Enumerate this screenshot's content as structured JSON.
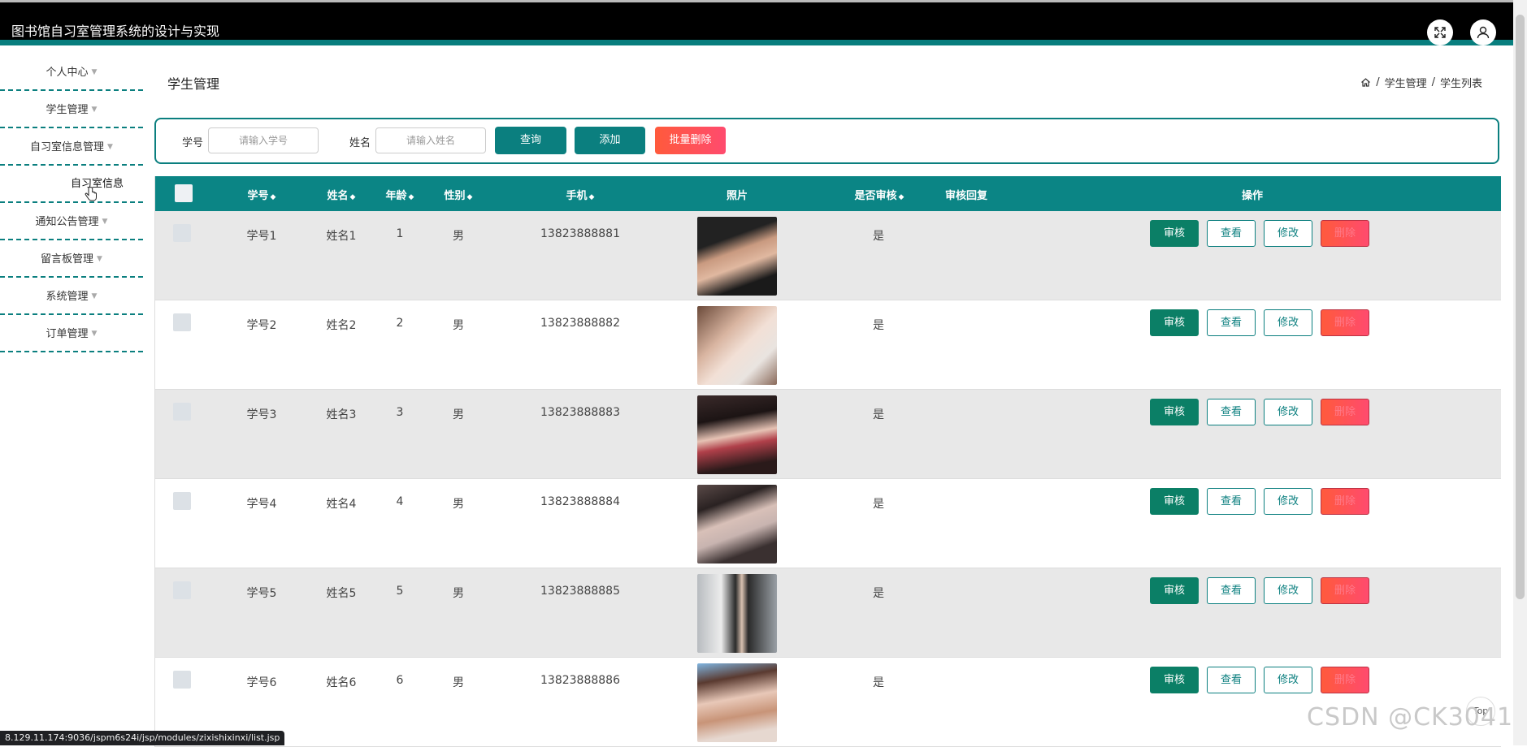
{
  "app": {
    "title": "图书馆自习室管理系统的设计与实现"
  },
  "header": {
    "fullscreen_icon": "expand-icon",
    "user_icon": "user-icon"
  },
  "sidebar": {
    "items": [
      {
        "label": "个人中心"
      },
      {
        "label": "学生管理"
      },
      {
        "label": "自习室信息管理"
      },
      {
        "label": "自习室信息"
      },
      {
        "label": "通知公告管理"
      },
      {
        "label": "留言板管理"
      },
      {
        "label": "系统管理"
      },
      {
        "label": "订单管理"
      }
    ]
  },
  "page": {
    "title": "学生管理"
  },
  "breadcrumb": {
    "home_icon": "home-icon",
    "sep": "/",
    "level1": "学生管理",
    "level2": "学生列表"
  },
  "search": {
    "student_id_label": "学号",
    "student_id_placeholder": "请输入学号",
    "name_label": "姓名",
    "name_placeholder": "请输入姓名",
    "query_button": "查询",
    "add_button": "添加",
    "batch_delete_button": "批量删除"
  },
  "table": {
    "columns": [
      "学号",
      "姓名",
      "年龄",
      "性别",
      "手机",
      "照片",
      "是否审核",
      "审核回复",
      "操作"
    ],
    "actions": {
      "audit": "审核",
      "view": "查看",
      "edit": "修改",
      "delete": "删除"
    },
    "rows": [
      {
        "student_id": "学号1",
        "name": "姓名1",
        "age": "1",
        "gender": "男",
        "phone": "13823888881",
        "reviewed": "是",
        "reply": ""
      },
      {
        "student_id": "学号2",
        "name": "姓名2",
        "age": "2",
        "gender": "男",
        "phone": "13823888882",
        "reviewed": "是",
        "reply": ""
      },
      {
        "student_id": "学号3",
        "name": "姓名3",
        "age": "3",
        "gender": "男",
        "phone": "13823888883",
        "reviewed": "是",
        "reply": ""
      },
      {
        "student_id": "学号4",
        "name": "姓名4",
        "age": "4",
        "gender": "男",
        "phone": "13823888884",
        "reviewed": "是",
        "reply": ""
      },
      {
        "student_id": "学号5",
        "name": "姓名5",
        "age": "5",
        "gender": "男",
        "phone": "13823888885",
        "reviewed": "是",
        "reply": ""
      },
      {
        "student_id": "学号6",
        "name": "姓名6",
        "age": "6",
        "gender": "男",
        "phone": "13823888886",
        "reviewed": "是",
        "reply": ""
      }
    ]
  },
  "status_url": "8.129.11.174:9036/jspm6s24i/jsp/modules/zixishixinxi/list.jsp",
  "top_button": "Top",
  "watermark": "CSDN @CK3041",
  "colors": {
    "primary": "#0b7f7f",
    "danger": "#ff5a3c",
    "header_bg": "#000000"
  }
}
